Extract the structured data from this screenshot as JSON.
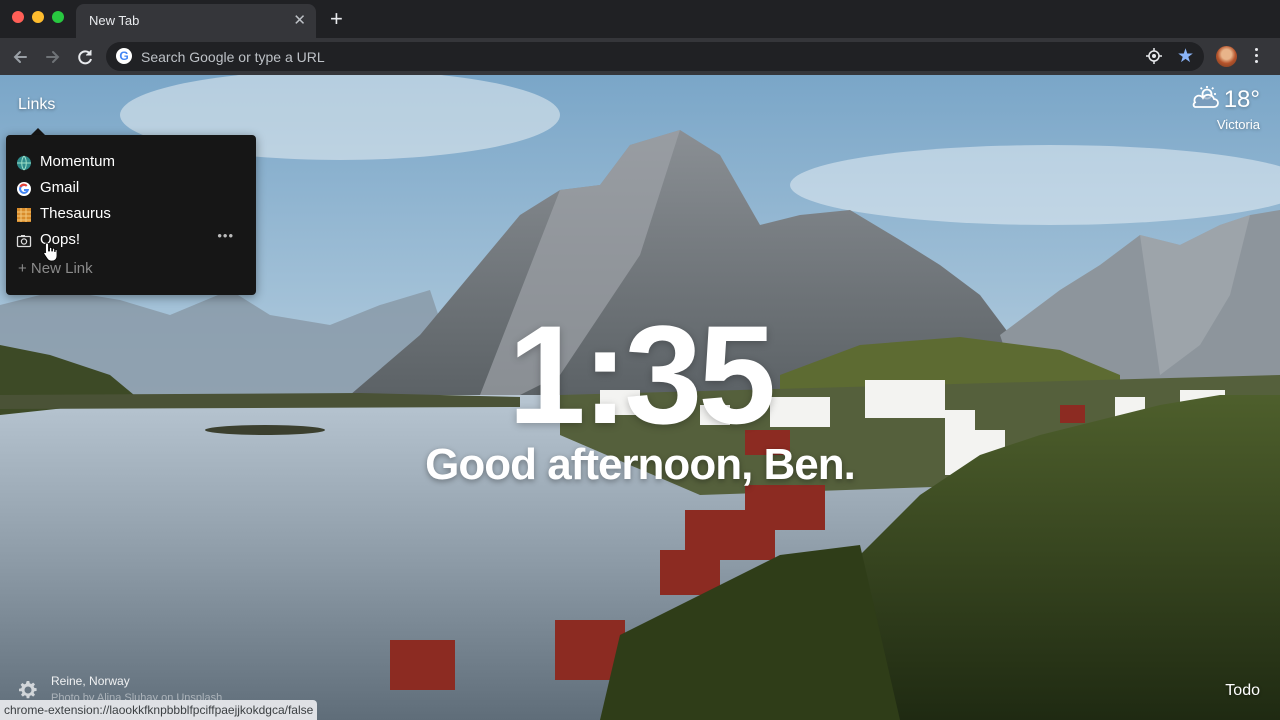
{
  "browser": {
    "tab_title": "New Tab",
    "tab_close": "✕",
    "new_tab": "+",
    "omnibox_placeholder": "Search Google or type a URL",
    "google_letter": "G"
  },
  "links": {
    "label": "Links",
    "items": [
      {
        "label": "Momentum",
        "icon": "momentum-globe-icon"
      },
      {
        "label": "Gmail",
        "icon": "google-icon"
      },
      {
        "label": "Thesaurus",
        "icon": "thesaurus-icon"
      },
      {
        "label": "Oops!",
        "icon": "camera-icon",
        "more": "•••"
      }
    ],
    "new_link": "+   New Link"
  },
  "weather": {
    "temperature": "18°",
    "location": "Victoria",
    "icon": "partly-cloudy-icon"
  },
  "clock": {
    "time": "1:35"
  },
  "greeting": {
    "text": "Good afternoon, Ben."
  },
  "photo": {
    "location": "Reine, Norway",
    "credit": "Photo by Alina Sluhay on Unsplash"
  },
  "status_bar": {
    "url": "chrome-extension://laookkfknpbbblfpciffpaejjkokdgca/false"
  },
  "todo": {
    "label": "Todo"
  },
  "colors": {
    "tabstrip": "#202124",
    "toolbar": "#35363a",
    "star": "#8ab4f8",
    "links_panel": "#161616"
  }
}
